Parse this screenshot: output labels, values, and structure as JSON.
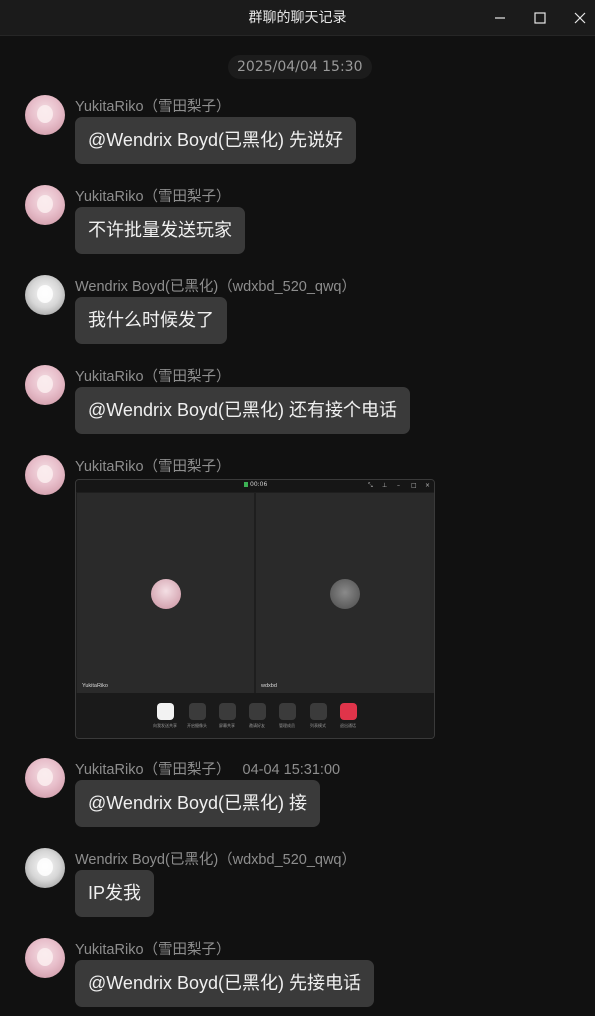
{
  "window": {
    "title": "群聊的聊天记录",
    "minimize_glyph": "—",
    "maximize_glyph": "☐",
    "close_glyph": "✕"
  },
  "timestamp": "2025/04/04 15:30",
  "senders": {
    "riko": "YukitaRiko（雪田梨子）",
    "wendrix": "Wendrix Boyd(已黑化)（wdxbd_520_qwq）"
  },
  "messages": [
    {
      "sender": "YukitaRiko（雪田梨子）",
      "text": "@Wendrix Boyd(已黑化) 先说好"
    },
    {
      "sender": "YukitaRiko（雪田梨子）",
      "text": "不许批量发送玩家"
    },
    {
      "sender": "Wendrix Boyd(已黑化)（wdxbd_520_qwq）",
      "text": "我什么时候发了"
    },
    {
      "sender": "YukitaRiko（雪田梨子）",
      "text": "@Wendrix Boyd(已黑化) 还有接个电话"
    },
    {
      "sender": "YukitaRiko（雪田梨子）",
      "text": ""
    },
    {
      "sender": "YukitaRiko（雪田梨子）",
      "time": "04-04 15:31:00",
      "text": "@Wendrix Boyd(已黑化) 接"
    },
    {
      "sender": "Wendrix Boyd(已黑化)（wdxbd_520_qwq）",
      "text": "IP发我"
    },
    {
      "sender": "YukitaRiko（雪田梨子）",
      "text": "@Wendrix Boyd(已黑化) 先接电话"
    }
  ],
  "call_screenshot": {
    "duration": "00:06",
    "left_name": "YukitaRiko",
    "right_name": "wdxbd",
    "controls": [
      "向我发送共享",
      "开启摄像头",
      "屏幕共享",
      "邀请好友",
      "管理成员",
      "列表模式",
      "退出通话"
    ]
  },
  "icons": {
    "avatar_riko": "pink-haired-anime-avatar",
    "avatar_wendrix": "white-haired-anime-avatar"
  }
}
